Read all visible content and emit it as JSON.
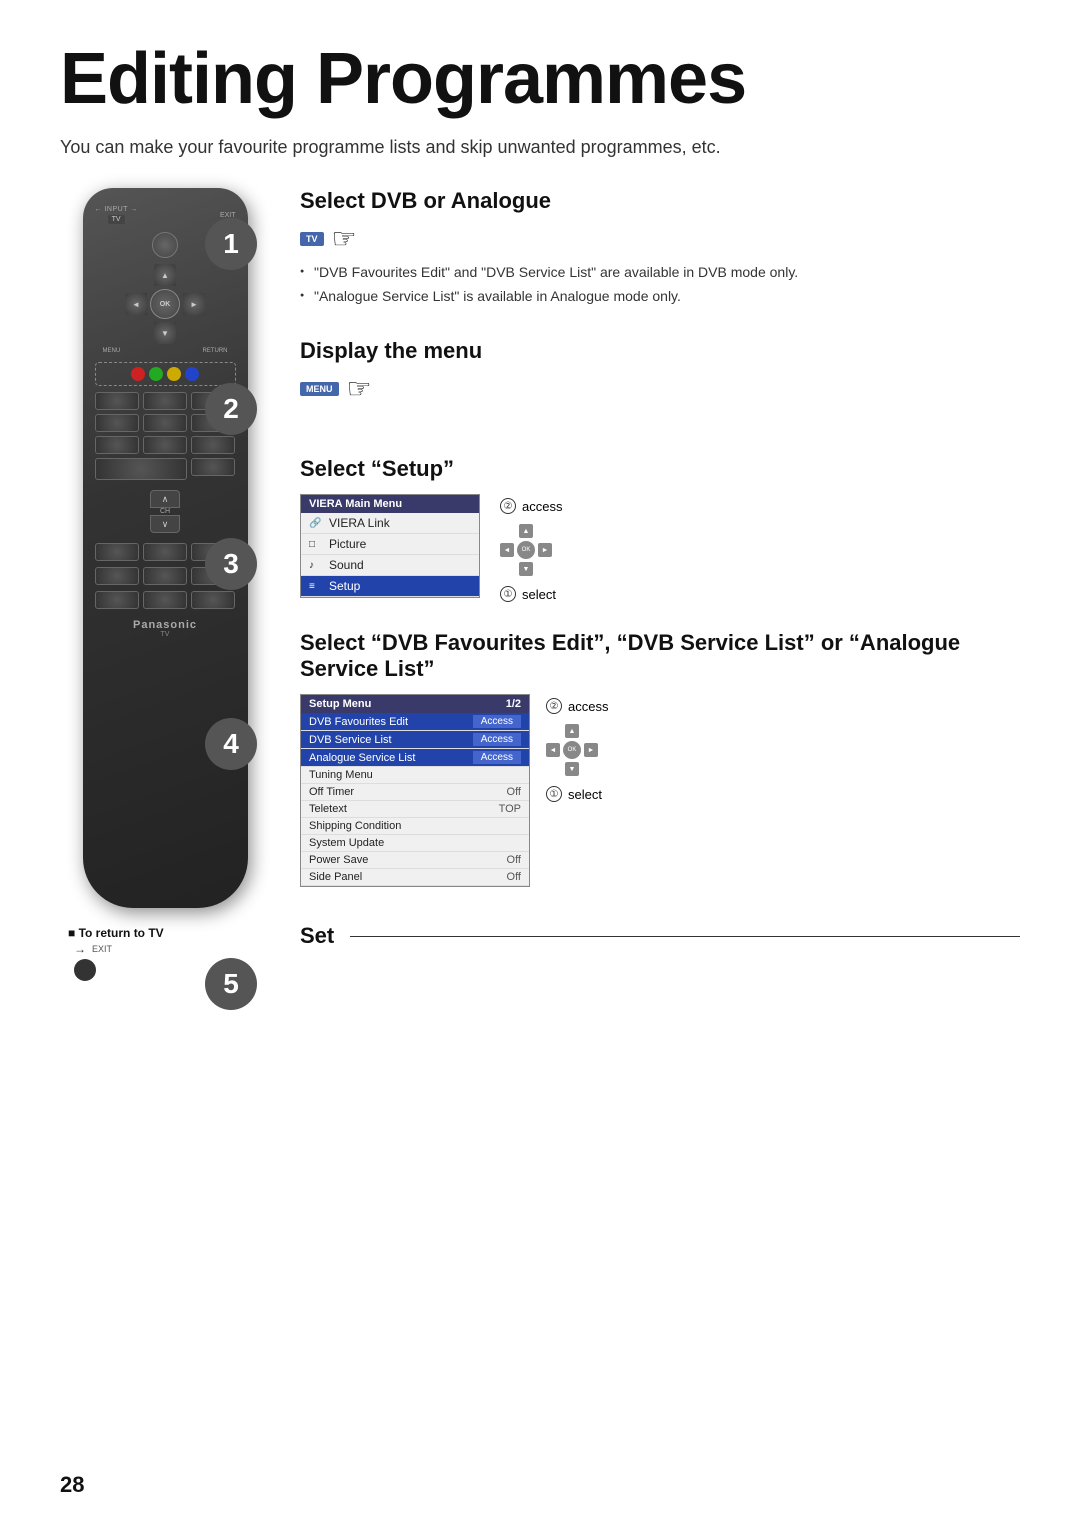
{
  "page": {
    "title": "Editing Programmes",
    "subtitle": "You can make your favourite programme lists and skip unwanted programmes, etc.",
    "page_number": "28"
  },
  "steps": [
    {
      "number": "1",
      "title": "Select DVB or Analogue",
      "button_label": "TV",
      "bullets": [
        "\"DVB Favourites Edit\" and \"DVB Service List\" are available in DVB mode only.",
        "\"Analogue Service List\" is available in Analogue mode only."
      ]
    },
    {
      "number": "2",
      "title": "Display the menu",
      "button_label": "MENU"
    },
    {
      "number": "3",
      "title": "Select “Setup”",
      "menu": {
        "header": "VIERA Main Menu",
        "items": [
          {
            "icon": "link",
            "label": "VIERA Link",
            "selected": false
          },
          {
            "icon": "picture",
            "label": "Picture",
            "selected": false
          },
          {
            "icon": "sound",
            "label": "Sound",
            "selected": false
          },
          {
            "icon": "setup",
            "label": "Setup",
            "selected": true
          }
        ]
      },
      "nav_labels": [
        "access",
        "select"
      ]
    },
    {
      "number": "4",
      "title": "Select “DVB Favourites Edit”, “DVB Service List” or “Analogue Service List”",
      "setup_menu": {
        "header": "Setup Menu",
        "page": "1/2",
        "rows": [
          {
            "label": "DVB Favourites Edit",
            "value": "Access",
            "has_badge": true,
            "selected": true
          },
          {
            "label": "DVB Service List",
            "value": "Access",
            "has_badge": true,
            "selected": true
          },
          {
            "label": "Analogue Service List",
            "value": "Access",
            "has_badge": true,
            "selected": true
          },
          {
            "label": "Tuning Menu",
            "value": "",
            "has_badge": false,
            "selected": false
          },
          {
            "label": "Off Timer",
            "value": "Off",
            "has_badge": false,
            "selected": false
          },
          {
            "label": "Teletext",
            "value": "TOP",
            "has_badge": false,
            "selected": false
          },
          {
            "label": "Shipping Condition",
            "value": "",
            "has_badge": false,
            "selected": false
          },
          {
            "label": "System Update",
            "value": "",
            "has_badge": false,
            "selected": false
          },
          {
            "label": "Power Save",
            "value": "Off",
            "has_badge": false,
            "selected": false
          },
          {
            "label": "Side Panel",
            "value": "Off",
            "has_badge": false,
            "selected": false
          }
        ]
      },
      "nav_labels": [
        "access",
        "select"
      ]
    },
    {
      "number": "5",
      "title": "Set"
    }
  ],
  "return_to_tv": {
    "label": "■ To return to TV",
    "exit_label": "EXIT"
  },
  "remote": {
    "brand": "Panasonic",
    "tv_label": "TV"
  },
  "icons": {
    "hand": "👌",
    "up_arrow": "▲",
    "down_arrow": "▼",
    "left_arrow": "◄",
    "right_arrow": "►"
  }
}
